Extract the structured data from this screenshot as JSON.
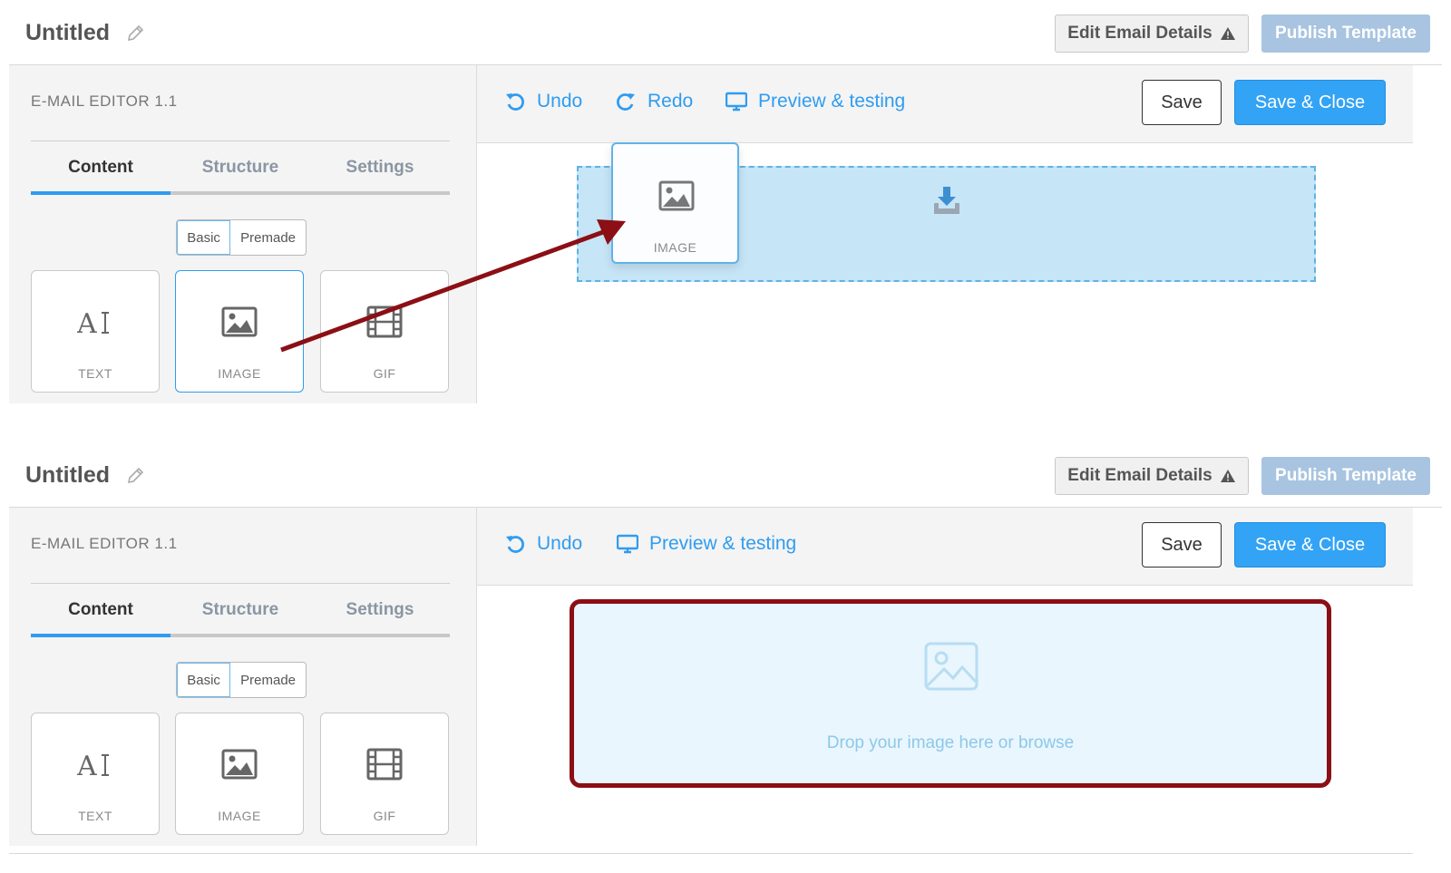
{
  "panels": [
    {
      "header": {
        "title": "Untitled",
        "edit_details_label": "Edit Email Details",
        "publish_label": "Publish Template"
      },
      "sidebar": {
        "editor_label": "E-MAIL EDITOR 1.1",
        "tabs": [
          {
            "label": "Content",
            "active": true
          },
          {
            "label": "Structure"
          },
          {
            "label": "Settings"
          }
        ],
        "segment": {
          "basic": "Basic",
          "premade": "Premade"
        },
        "blocks": [
          {
            "label": "TEXT",
            "icon": "text-icon"
          },
          {
            "label": "IMAGE",
            "icon": "image-icon",
            "highlighted": true
          },
          {
            "label": "GIF",
            "icon": "film-icon"
          }
        ]
      },
      "toolbar": {
        "undo": "Undo",
        "redo": "Redo",
        "preview": "Preview & testing",
        "save": "Save",
        "save_close": "Save & Close"
      },
      "canvas": {
        "drag_block_label": "IMAGE",
        "drop_icon": "download-tray-icon"
      }
    },
    {
      "header": {
        "title": "Untitled",
        "edit_details_label": "Edit Email Details",
        "publish_label": "Publish Template"
      },
      "sidebar": {
        "editor_label": "E-MAIL EDITOR 1.1",
        "tabs": [
          {
            "label": "Content",
            "active": true
          },
          {
            "label": "Structure"
          },
          {
            "label": "Settings"
          }
        ],
        "segment": {
          "basic": "Basic",
          "premade": "Premade"
        },
        "blocks": [
          {
            "label": "TEXT",
            "icon": "text-icon"
          },
          {
            "label": "IMAGE",
            "icon": "image-icon"
          },
          {
            "label": "GIF",
            "icon": "film-icon"
          }
        ]
      },
      "toolbar": {
        "undo": "Undo",
        "preview": "Preview & testing",
        "save": "Save",
        "save_close": "Save & Close"
      },
      "canvas": {
        "dropzone_text": "Drop your image here or browse",
        "dropzone_icon": "image-placeholder-icon"
      }
    }
  ],
  "colors": {
    "accent": "#2f9cf0",
    "publish_disabled": "#a8c4e0",
    "annotation": "#8b0f14",
    "dropzone": "#c6e5f7"
  }
}
